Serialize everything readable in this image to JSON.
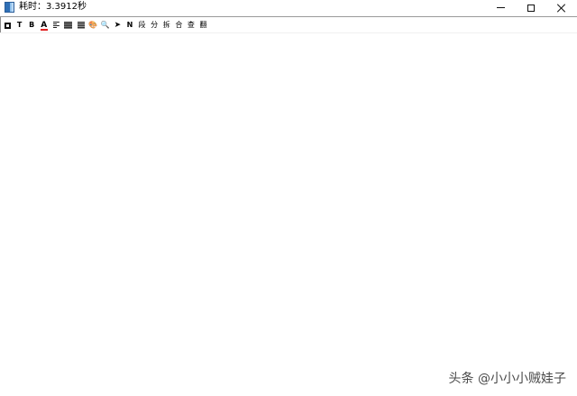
{
  "window": {
    "title": "耗时：3.3912秒",
    "icon": "app-book-icon"
  },
  "controls": {
    "minimize": "minimize-icon",
    "maximize": "maximize-icon",
    "close": "close-icon"
  },
  "toolbar": {
    "items": [
      {
        "name": "box-icon",
        "label": ""
      },
      {
        "name": "text-t-icon",
        "label": "T"
      },
      {
        "name": "bold-b-icon",
        "label": "B"
      },
      {
        "name": "font-color-icon",
        "label": "A"
      },
      {
        "name": "align-left-icon",
        "label": ""
      },
      {
        "name": "align-justify-icon",
        "label": ""
      },
      {
        "name": "list-icon",
        "label": ""
      },
      {
        "name": "palette-icon",
        "label": "🎨"
      },
      {
        "name": "search-icon",
        "label": "🔍"
      },
      {
        "name": "send-icon",
        "label": "➤"
      },
      {
        "name": "n-icon",
        "label": "N"
      },
      {
        "name": "paragraph-button",
        "label": "段"
      },
      {
        "name": "split-button",
        "label": "分"
      },
      {
        "name": "unsplit-button",
        "label": "拆"
      },
      {
        "name": "merge-button",
        "label": "合"
      },
      {
        "name": "check-button",
        "label": "查"
      },
      {
        "name": "translate-button",
        "label": "翻"
      }
    ]
  },
  "watermark": {
    "text": "头条 @小小小贼娃子"
  },
  "colors": {
    "font_color_underline": "#e02020",
    "border": "#8a8a8a",
    "background": "#ffffff"
  }
}
